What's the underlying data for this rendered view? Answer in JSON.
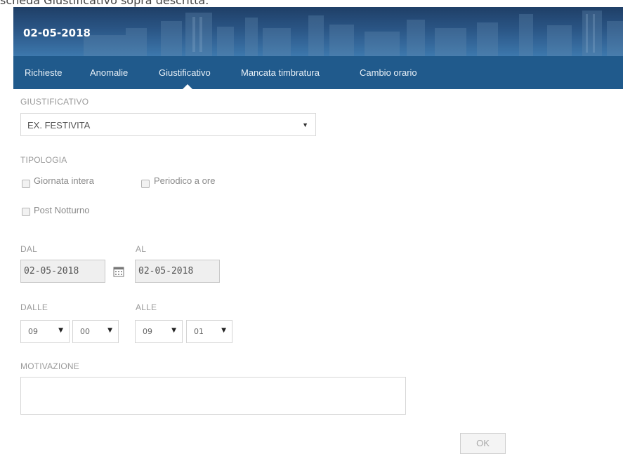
{
  "page_caption": "scheda Giustificativo sopra descritta.",
  "header": {
    "date_title": "02-05-2018"
  },
  "tabs": [
    {
      "label": "Richieste",
      "active": false
    },
    {
      "label": "Anomalie",
      "active": false
    },
    {
      "label": "Giustificativo",
      "active": true
    },
    {
      "label": "Mancata timbratura",
      "active": false
    },
    {
      "label": "Cambio orario",
      "active": false
    }
  ],
  "form": {
    "giustificativo_label": "GIUSTIFICATIVO",
    "giustificativo_value": "EX. FESTIVITA",
    "tipologia_label": "TIPOLOGIA",
    "checkboxes": [
      {
        "label": "Giornata intera",
        "checked": false
      },
      {
        "label": "Periodico a ore",
        "checked": false
      },
      {
        "label": "Post Notturno",
        "checked": false
      }
    ],
    "dal_label": "DAL",
    "dal_value": "02-05-2018",
    "al_label": "AL",
    "al_value": "02-05-2018",
    "dalle_label": "DALLE",
    "alle_label": "ALLE",
    "dalle_hour": "09",
    "dalle_min": "00",
    "alle_hour": "09",
    "alle_min": "01",
    "motivazione_label": "MOTIVAZIONE",
    "motivazione_value": "",
    "ok_label": "OK"
  },
  "colors": {
    "header_bg": "#205a8c",
    "tab_text": "#e9f1f8"
  },
  "icons": {
    "dropdown": "caret-down-icon",
    "calendar": "calendar-icon"
  }
}
